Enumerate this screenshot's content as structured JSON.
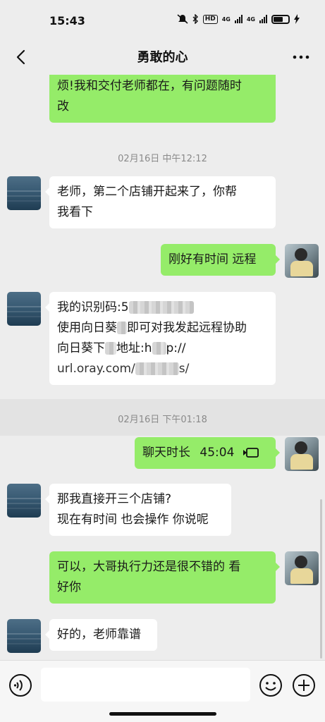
{
  "status_bar": {
    "time": "15:43",
    "hd": "HD",
    "net1": "4G",
    "net2": "4G"
  },
  "header": {
    "title": "勇敢的心"
  },
  "messages": {
    "m0": {
      "line1": "烦!我和交付老师都在，有问题随时",
      "line2": "改"
    },
    "ts1": "02月16日 中午12:12",
    "m1": {
      "line1": "老师，第二个店铺开起来了，你帮",
      "line2": "我看下"
    },
    "m2": "刚好有时间  远程",
    "m3": {
      "line1_a": "我的识别码:",
      "line1_b": "5",
      "line2_a": "使用向日葵",
      "line2_b": "即可对我发起远程协助",
      "line3_a": "向日葵下",
      "line3_b": "地址:h",
      "line3_c": "p://",
      "line4_a": "url.oray.com/",
      "line4_b": "s/"
    },
    "ts2": "02月16日 下午01:18",
    "m4": {
      "label": "聊天时长",
      "duration": "45:04"
    },
    "m5": {
      "line1": "那我直接开三个店铺?",
      "line2": "现在有时间 也会操作 你说呢"
    },
    "m6": {
      "line1": "可以，大哥执行力还是很不错的 看",
      "line2": "好你"
    },
    "m7": "好的，老师靠谱"
  },
  "input": {
    "placeholder": ""
  },
  "colors": {
    "outgoing_bubble": "#95ec69",
    "incoming_bubble": "#ffffff",
    "background": "#ededed"
  }
}
